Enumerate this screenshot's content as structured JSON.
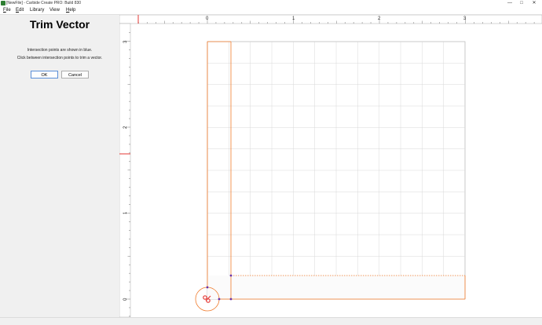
{
  "window": {
    "title": "[NewFile] - Carbide Create PRO: Build 830",
    "minimize": "—",
    "maximize": "□",
    "close": "✕"
  },
  "menu": [
    {
      "mn": "F",
      "rest": "ile"
    },
    {
      "mn": "E",
      "rest": "dit"
    },
    {
      "mn": "",
      "rest": "Library"
    },
    {
      "mn": "",
      "rest": "View"
    },
    {
      "mn": "H",
      "rest": "elp"
    }
  ],
  "panel": {
    "title": "Trim Vector",
    "instruction_1": "Intersection points are shown in blue.",
    "instruction_2": "Click between intersection points to trim a vector.",
    "ok_label": "OK",
    "cancel_label": "Cancel"
  },
  "ruler": {
    "horizontal_labels": [
      "0",
      "1",
      "2",
      "3"
    ],
    "vertical_labels": [
      "0",
      "1",
      "2",
      "3"
    ]
  },
  "colors": {
    "vector": "#f07a2a",
    "intersection": "#6633aa",
    "cursor": "#e53935",
    "grid": "#d8d8d8"
  }
}
